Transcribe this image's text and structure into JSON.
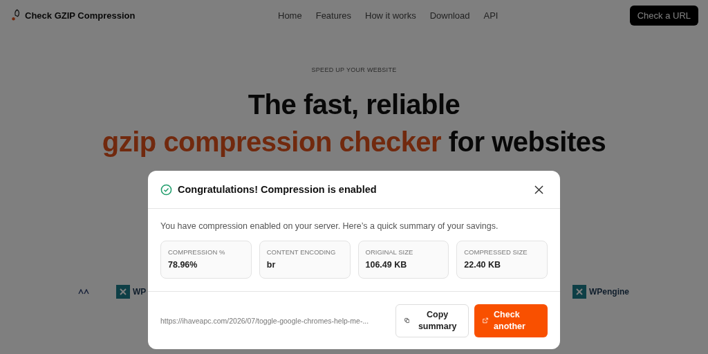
{
  "nav": {
    "brand": "Check GZIP Compression",
    "links": [
      "Home",
      "Features",
      "How it works",
      "Download",
      "API"
    ],
    "cta": "Check a URL"
  },
  "hero": {
    "kicker": "SPEED UP YOUR WEBSITE",
    "line1": "The fast, reliable",
    "highlight": "gzip compression checker",
    "rest": "for websites"
  },
  "logos": [
    {
      "text": "WP"
    },
    {
      "text": "WPengine"
    }
  ],
  "modal": {
    "title": "Congratulations! Compression is enabled",
    "intro": "You have compression enabled on your server. Here’s a quick summary of your savings.",
    "stats": [
      {
        "label": "COMPRESSION %",
        "value": "78.96%"
      },
      {
        "label": "CONTENT ENCODING",
        "value": "br"
      },
      {
        "label": "ORIGINAL SIZE",
        "value": "106.49 KB"
      },
      {
        "label": "COMPRESSED SIZE",
        "value": "22.40 KB"
      }
    ],
    "url": "https://ihaveapc.com/2026/07/toggle-google-chromes-help-me-...",
    "copy": "Copy summary",
    "check": "Check another"
  }
}
